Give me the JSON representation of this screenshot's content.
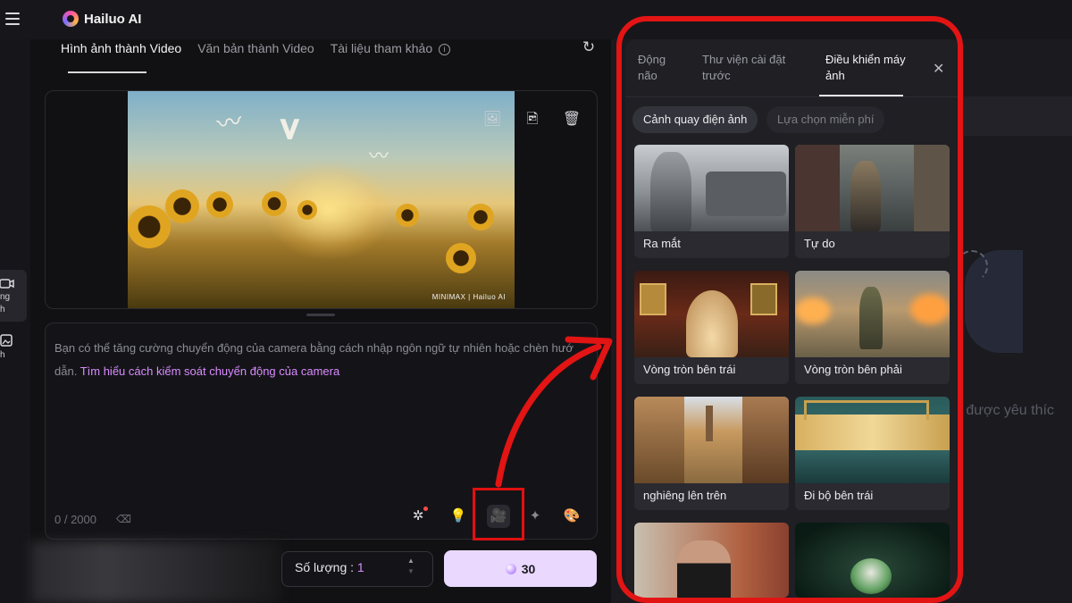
{
  "app": {
    "brand": "Hailuo AI"
  },
  "main": {
    "tabs": [
      {
        "label": "Hình ảnh thành Video",
        "active": true
      },
      {
        "label": "Văn bản thành Video",
        "active": false
      },
      {
        "label": "Tài liệu tham khảo",
        "active": false
      }
    ],
    "info_glyph": "i",
    "watermark": "MINIMAX | Hailuo AI",
    "prompt": {
      "text": "Bạn có thể tăng cường chuyển động của camera bằng cách nhập ngôn ngữ tự nhiên hoặc chèn hướ dẫn.",
      "link": "Tìm hiểu cách kiểm soát chuyển động của camera",
      "counter": "0 / 2000"
    },
    "quantity": {
      "label": "Số lượng :",
      "value": "1"
    },
    "generate": {
      "cost": "30"
    }
  },
  "rail": {
    "items": [
      {
        "label": "ng h",
        "active": true
      },
      {
        "label": "h",
        "active": false
      }
    ]
  },
  "right": {
    "hint": "o được yêu thíc"
  },
  "dropdown": {
    "tabs": [
      {
        "label": "Động não",
        "active": false
      },
      {
        "label": "Thư viện cài đặt trước",
        "active": false
      },
      {
        "label": "Điều khiển máy ảnh",
        "active": true
      }
    ],
    "chips": [
      {
        "label": "Cảnh quay điện ảnh",
        "active": true
      },
      {
        "label": "Lựa chọn miễn phí",
        "active": false
      }
    ],
    "cards": [
      {
        "label": "Ra mắt"
      },
      {
        "label": "Tự do"
      },
      {
        "label": "Vòng tròn bên trái"
      },
      {
        "label": "Vòng tròn bên phải"
      },
      {
        "label": "nghiêng lên trên"
      },
      {
        "label": "Đi bộ bên trái"
      },
      {
        "label": ""
      },
      {
        "label": ""
      }
    ]
  },
  "colors": {
    "accent": "#d98cff",
    "highlight_red": "#e31414",
    "button_bg": "#ead8ff"
  },
  "icons": [
    "menu-icon",
    "logo-icon",
    "reset-icon",
    "info-icon",
    "image-icon",
    "image-edit-icon",
    "trash-icon",
    "magic-icon",
    "lightbulb-icon",
    "camera-movie-icon",
    "wand-icon",
    "palette-icon",
    "eraser-icon",
    "close-icon"
  ]
}
